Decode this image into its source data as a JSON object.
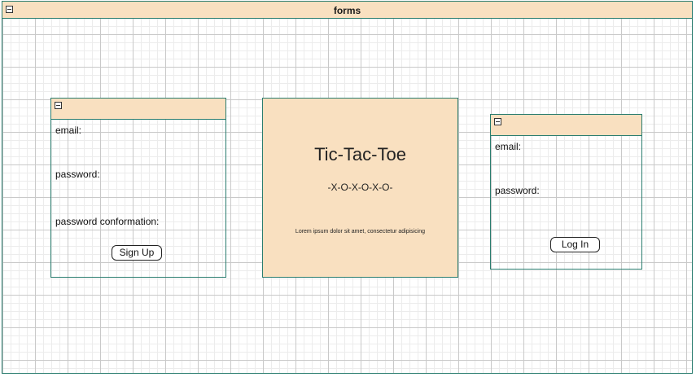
{
  "diagram": {
    "title": "forms",
    "signup_form": {
      "email_label": "email:",
      "password_label": "password:",
      "confirm_label": "password conformation:",
      "button_label": "Sign Up"
    },
    "title_card": {
      "heading": "Tic-Tac-Toe",
      "subheading": "-X-O-X-O-X-O-",
      "body": "Lorem ipsum dolor sit amet, consectetur adipisicing"
    },
    "login_form": {
      "email_label": "email:",
      "password_label": "password:",
      "button_label": "Log In"
    },
    "colors": {
      "header_fill": "#f9e0c0",
      "border": "#2a7d6f"
    },
    "icons": [
      "collapse-icon"
    ]
  }
}
